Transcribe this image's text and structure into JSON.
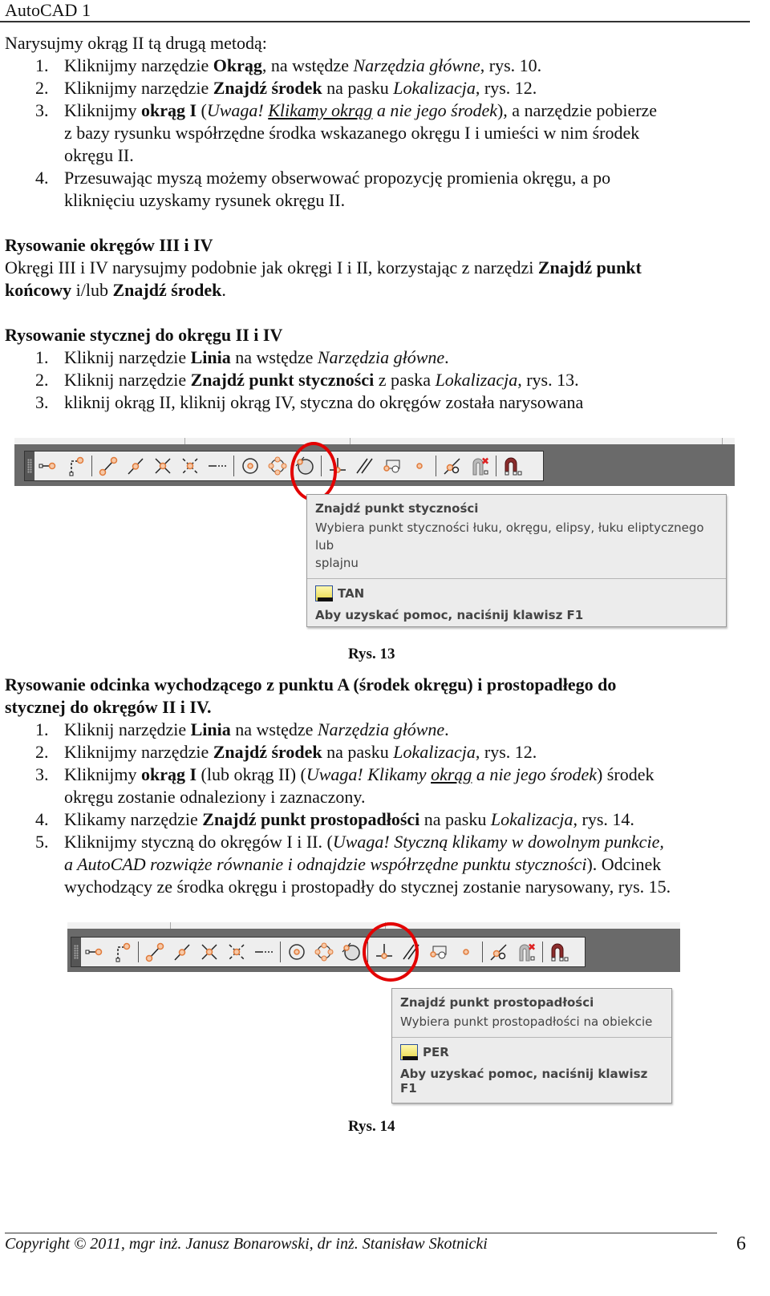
{
  "header": {
    "title": "AutoCAD 1"
  },
  "section1": {
    "intro": "Narysujmy okrąg II tą drugą metodą:",
    "steps": [
      {
        "num": "1.",
        "parts": [
          {
            "t": "Kliknijmy narzędzie "
          },
          {
            "t": "Okrąg",
            "b": true
          },
          {
            "t": ", na wstędze "
          },
          {
            "t": "Narzędzia główne",
            "i": true
          },
          {
            "t": ", rys. 10."
          }
        ]
      },
      {
        "num": "2.",
        "parts": [
          {
            "t": "Kliknijmy narzędzie "
          },
          {
            "t": "Znajdź środek",
            "b": true
          },
          {
            "t": " na pasku "
          },
          {
            "t": "Lokalizacja",
            "i": true
          },
          {
            "t": ", rys. 12."
          }
        ]
      },
      {
        "num": "3.",
        "lines": [
          [
            {
              "t": "Kliknijmy "
            },
            {
              "t": "okrąg I",
              "b": true
            },
            {
              "t": " ("
            },
            {
              "t": "Uwaga! ",
              "i": true
            },
            {
              "t": "Klikamy okrąg",
              "i": true,
              "u": true
            },
            {
              "t": " a nie jego środek",
              "i": true
            },
            {
              "t": "), a narzędzie pobierze"
            }
          ],
          [
            {
              "t": "z bazy rysunku współrzędne środka wskazanego okręgu I i umieści w nim środek"
            }
          ],
          [
            {
              "t": "okręgu II."
            }
          ]
        ]
      },
      {
        "num": "4.",
        "lines": [
          [
            {
              "t": "Przesuwając myszą możemy obserwować propozycję promienia okręgu, a po"
            }
          ],
          [
            {
              "t": "kliknięciu uzyskamy rysunek okręgu II."
            }
          ]
        ]
      }
    ]
  },
  "section2": {
    "heading": "Rysowanie okręgów III i IV",
    "lines": [
      [
        {
          "t": "Okręgi III i IV narysujmy podobnie jak okręgi I i II, korzystając z narzędzi "
        },
        {
          "t": "Znajdź punkt",
          "b": true
        }
      ],
      [
        {
          "t": "końcowy",
          "b": true
        },
        {
          "t": " i/lub "
        },
        {
          "t": "Znajdź środek",
          "b": true
        },
        {
          "t": "."
        }
      ]
    ]
  },
  "section3": {
    "heading": "Rysowanie stycznej do okręgu II i IV",
    "steps": [
      {
        "num": "1.",
        "parts": [
          {
            "t": "Kliknij narzędzie "
          },
          {
            "t": "Linia",
            "b": true
          },
          {
            "t": " na wstędze "
          },
          {
            "t": "Narzędzia główne",
            "i": true
          },
          {
            "t": "."
          }
        ]
      },
      {
        "num": "2.",
        "parts": [
          {
            "t": "Kliknij narzędzie "
          },
          {
            "t": "Znajdź punkt styczności",
            "b": true
          },
          {
            "t": " z paska "
          },
          {
            "t": "Lokalizacja",
            "i": true
          },
          {
            "t": ", rys. 13."
          }
        ]
      },
      {
        "num": "3.",
        "parts": [
          {
            "t": "kliknij okrąg II, kliknij okrąg IV, styczna do okręgów została narysowana"
          }
        ]
      }
    ]
  },
  "figure13": {
    "caption": "Rys. 13",
    "highlighted_tool": "tangent-snap",
    "tooltip": {
      "title": "Znajdź punkt styczności",
      "description_line1": "Wybiera punkt styczności łuku, okręgu, elipsy, łuku eliptycznego lub",
      "description_line2": "splajnu",
      "command": "TAN",
      "help": "Aby uzyskać pomoc, naciśnij klawisz F1"
    }
  },
  "section4": {
    "heading_line1": "Rysowanie odcinka wychodzącego z punktu A (środek okręgu) i prostopadłego do",
    "heading_line2": "stycznej do okręgów II i IV.",
    "steps": [
      {
        "num": "1.",
        "lines": [
          [
            {
              "t": "Kliknij narzędzie "
            },
            {
              "t": "Linia",
              "b": true
            },
            {
              "t": " na wstędze "
            },
            {
              "t": "Narzędzia główne",
              "i": true
            },
            {
              "t": "."
            }
          ]
        ]
      },
      {
        "num": "2.",
        "lines": [
          [
            {
              "t": "Kliknijmy narzędzie "
            },
            {
              "t": "Znajdź środek",
              "b": true
            },
            {
              "t": " na pasku "
            },
            {
              "t": "Lokalizacja",
              "i": true
            },
            {
              "t": ", rys. 12."
            }
          ]
        ]
      },
      {
        "num": "3.",
        "lines": [
          [
            {
              "t": "Kliknijmy "
            },
            {
              "t": "okrąg I",
              "b": true
            },
            {
              "t": " (lub okrąg II) ("
            },
            {
              "t": "Uwaga! Klikamy ",
              "i": true
            },
            {
              "t": "okrąg",
              "i": true,
              "u": true
            },
            {
              "t": " a nie jego środek",
              "i": true
            },
            {
              "t": ") środek"
            }
          ],
          [
            {
              "t": "okręgu zostanie odnaleziony i zaznaczony."
            }
          ]
        ]
      },
      {
        "num": "4.",
        "lines": [
          [
            {
              "t": "Klikamy narzędzie "
            },
            {
              "t": "Znajdź punkt prostopadłości",
              "b": true
            },
            {
              "t": " na pasku "
            },
            {
              "t": "Lokalizacja",
              "i": true
            },
            {
              "t": ", rys. 14."
            }
          ]
        ]
      },
      {
        "num": "5.",
        "lines": [
          [
            {
              "t": "Kliknijmy styczną do okręgów I i II. ("
            },
            {
              "t": "Uwaga! Styczną klikamy w dowolnym punkcie,",
              "i": true
            }
          ],
          [
            {
              "t": "a AutoCAD rozwiąże równanie i odnajdzie współrzędne punktu styczności",
              "i": true
            },
            {
              "t": "). Odcinek"
            }
          ],
          [
            {
              "t": "wychodzący ze środka okręgu i prostopadły do stycznej zostanie narysowany, rys. 15."
            }
          ]
        ]
      }
    ]
  },
  "figure14": {
    "caption": "Rys. 14",
    "highlighted_tool": "perpendicular-snap",
    "tooltip": {
      "title": "Znajdź punkt prostopadłości",
      "description_line1": "Wybiera punkt prostopadłości na obiekcie",
      "command": "PER",
      "help": "Aby uzyskać pomoc, naciśnij klawisz F1"
    }
  },
  "toolbar": {
    "tools": [
      "temporary-track-point",
      "snap-from",
      "endpoint",
      "midpoint",
      "intersection",
      "apparent-intersection",
      "extension",
      "center",
      "quadrant",
      "tangent",
      "perpendicular",
      "parallel",
      "insert",
      "node",
      "nearest",
      "osnap-none",
      "osnap-settings"
    ]
  },
  "footer": {
    "copyright": "Copyright © 2011, mgr inż. Janusz Bonarowski, dr inż. Stanisław Skotnicki",
    "page_number": "6"
  }
}
